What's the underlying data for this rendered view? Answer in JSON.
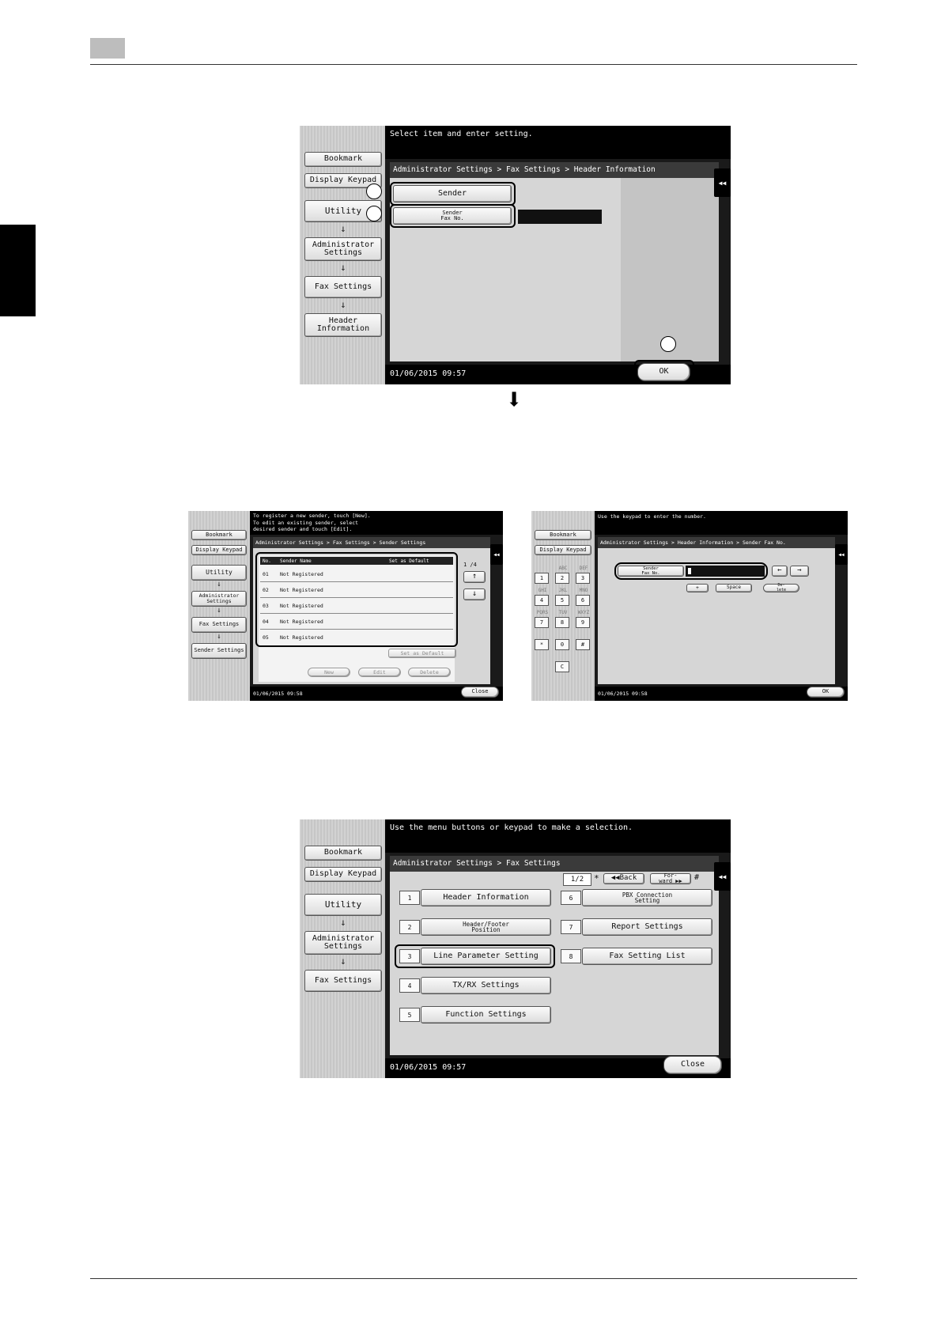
{
  "screen1": {
    "sidebar": [
      "Bookmark",
      "Display Keypad",
      "Utility",
      "Administrator\nSettings",
      "Fax Settings",
      "Header\nInformation"
    ],
    "arrow_glyph": "↓",
    "message": "Select item and enter setting.",
    "breadcrumb": "Administrator Settings  > Fax Settings  > Header Information",
    "sender_label": "Sender",
    "sender_fax_label": "Sender\nFax No.",
    "collapse_glyph": "◀◀",
    "datetime": "01/06/2015  09:57",
    "ok_label": "OK"
  },
  "flow_arrow": "⬇",
  "screen2": {
    "message": "To register a new sender, touch [New].\nTo edit an existing sender, select\ndesired sender and touch [Edit].",
    "sidebar": [
      "Bookmark",
      "Display Keypad",
      "Utility",
      "Administrator\nSettings",
      "Fax Settings",
      "Sender Settings"
    ],
    "breadcrumb": "Administrator Settings > Fax Settings > Sender Settings",
    "columns": [
      "No.",
      "Sender Name",
      "Set as Default"
    ],
    "rows": [
      {
        "no": "01",
        "name": "Not Registered"
      },
      {
        "no": "02",
        "name": "Not Registered"
      },
      {
        "no": "03",
        "name": "Not Registered"
      },
      {
        "no": "04",
        "name": "Not Registered"
      },
      {
        "no": "05",
        "name": "Not Registered"
      }
    ],
    "page": "1 /4",
    "up": "↑",
    "down": "↓",
    "set_default": "Set as Default",
    "new": "New",
    "edit": "Edit",
    "delete": "Delete",
    "datetime": "01/06/2015  09:58",
    "close": "Close"
  },
  "screen3": {
    "message": "Use the keypad to enter the number.",
    "sidebar": [
      "Bookmark",
      "Display Keypad"
    ],
    "breadcrumb": "Administrator Settings > Header Information > Sender Fax No.",
    "keypad_letters": [
      "ABC",
      "DEF",
      "GHI",
      "JKL",
      "MNO",
      "PQRS",
      "TUV",
      "WXYZ"
    ],
    "keys": [
      "1",
      "2",
      "3",
      "4",
      "5",
      "6",
      "7",
      "8",
      "9",
      "*",
      "0",
      "#",
      "C"
    ],
    "field_label": "Sender\nFax No.",
    "left_arrow": "←",
    "right_arrow": "→",
    "plus": "+",
    "space": "Space",
    "delete": "De-\nlete",
    "datetime": "01/06/2015  09:58",
    "ok": "OK"
  },
  "screen4": {
    "message": "Use the menu buttons or keypad to make a selection.",
    "sidebar": [
      "Bookmark",
      "Display Keypad",
      "Utility",
      "Administrator\nSettings",
      "Fax Settings"
    ],
    "breadcrumb": "Administrator Settings  > Fax Settings",
    "page": "1/2",
    "star": "*",
    "back": "◀◀Back",
    "forward": "For-\nward ▶▶",
    "hash": "#",
    "menu": [
      {
        "num": "1",
        "label": "Header Information"
      },
      {
        "num": "2",
        "label": "Header/Footer\nPosition"
      },
      {
        "num": "3",
        "label": "Line Parameter Setting"
      },
      {
        "num": "4",
        "label": "TX/RX Settings"
      },
      {
        "num": "5",
        "label": "Function Settings"
      },
      {
        "num": "6",
        "label": "PBX Connection\nSetting"
      },
      {
        "num": "7",
        "label": "Report Settings"
      },
      {
        "num": "8",
        "label": "Fax Setting List"
      }
    ],
    "datetime": "01/06/2015  09:57",
    "close": "Close"
  }
}
